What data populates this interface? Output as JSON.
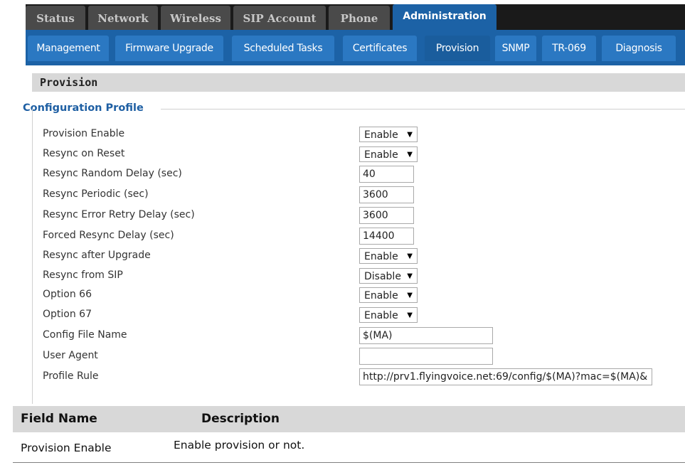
{
  "top_tabs": [
    {
      "label": "Status",
      "active": false
    },
    {
      "label": "Network",
      "active": false
    },
    {
      "label": "Wireless",
      "active": false
    },
    {
      "label": "SIP Account",
      "active": false
    },
    {
      "label": "Phone",
      "active": false
    },
    {
      "label": "Administration",
      "active": true
    }
  ],
  "sub_tabs": [
    {
      "label": "Management",
      "active": false
    },
    {
      "label": "Firmware Upgrade",
      "active": false
    },
    {
      "label": "Scheduled Tasks",
      "active": false
    },
    {
      "label": "Certificates",
      "active": false
    },
    {
      "label": "Provision",
      "active": true
    },
    {
      "label": "SNMP",
      "active": false
    },
    {
      "label": "TR-069",
      "active": false
    },
    {
      "label": "Diagnosis",
      "active": false
    }
  ],
  "section_title": "Provision",
  "config_profile": {
    "legend": "Configuration Profile",
    "fields": [
      {
        "label": "Provision Enable",
        "type": "select",
        "value": "Enable"
      },
      {
        "label": "Resync on Reset",
        "type": "select",
        "value": "Enable"
      },
      {
        "label": "Resync Random Delay (sec)",
        "type": "input",
        "value": "40"
      },
      {
        "label": "Resync Periodic (sec)",
        "type": "input",
        "value": "3600"
      },
      {
        "label": "Resync Error Retry Delay (sec)",
        "type": "input",
        "value": "3600"
      },
      {
        "label": "Forced Resync Delay (sec)",
        "type": "input",
        "value": "14400"
      },
      {
        "label": "Resync after Upgrade",
        "type": "select",
        "value": "Enable"
      },
      {
        "label": "Resync from SIP",
        "type": "select",
        "value": "Disable"
      },
      {
        "label": "Option 66",
        "type": "select",
        "value": "Enable"
      },
      {
        "label": "Option 67",
        "type": "select",
        "value": "Enable"
      },
      {
        "label": "Config File Name",
        "type": "input",
        "value": "$(MA)"
      },
      {
        "label": "User Agent",
        "type": "input",
        "value": ""
      },
      {
        "label": "Profile Rule",
        "type": "input",
        "value": "http://prv1.flyingvoice.net:69/config/$(MA)?mac=$(MA)&"
      }
    ]
  },
  "doc_table": {
    "headers": [
      "Field Name",
      "Description"
    ],
    "rows": [
      [
        "Provision Enable",
        "Enable provision or not."
      ]
    ]
  },
  "icons": {
    "select_arrow": "▼"
  },
  "colors": {
    "top_bar": "#1a1a1a",
    "inactive_tab": "#4a4a4a",
    "active_tab": "#1c62a6",
    "sub_bar": "#1c62a6",
    "sub_tab": "#2b78c2",
    "legend_text": "#1e5fa3",
    "header_gray": "#d8d8d8"
  }
}
